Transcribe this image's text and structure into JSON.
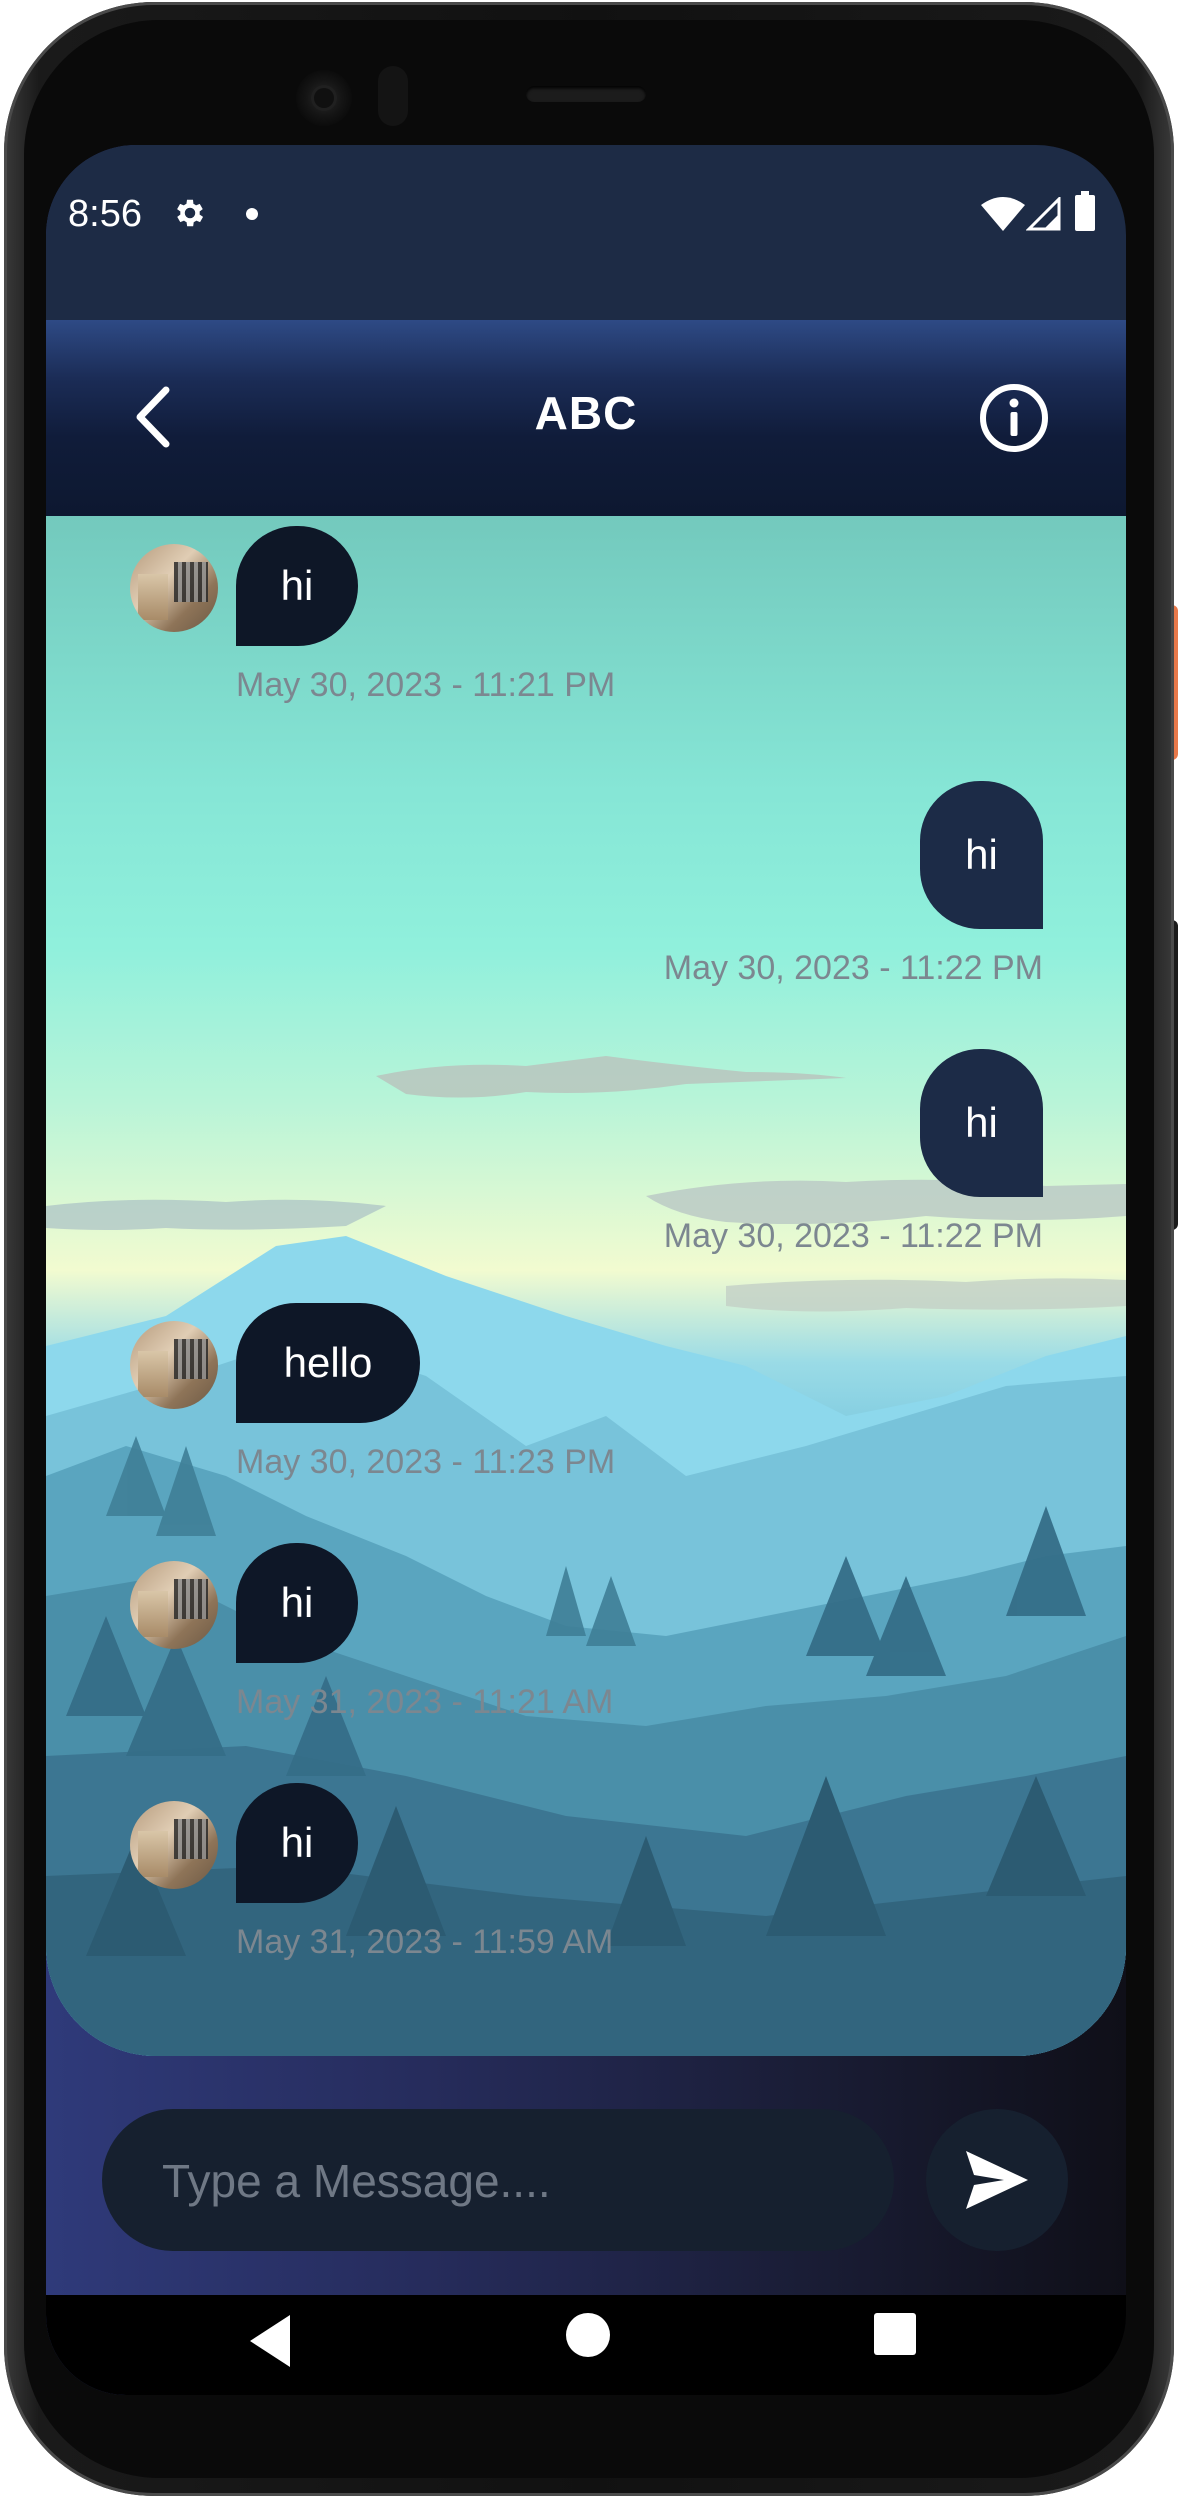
{
  "status_bar": {
    "time": "8:56",
    "icons": [
      "gear-icon",
      "notification-dot-icon",
      "wifi-icon",
      "signal-icon",
      "battery-icon"
    ]
  },
  "header": {
    "title": "ABC",
    "back_icon": "chevron-left-icon",
    "info_icon": "info-circle-icon"
  },
  "messages": [
    {
      "direction": "incoming",
      "text": "hi",
      "timestamp": "May 30, 2023 - 11:21 PM"
    },
    {
      "direction": "outgoing",
      "text": "hi",
      "timestamp": "May 30, 2023 - 11:22 PM"
    },
    {
      "direction": "outgoing",
      "text": "hi",
      "timestamp": "May 30, 2023 - 11:22 PM"
    },
    {
      "direction": "incoming",
      "text": "hello",
      "timestamp": "May 30, 2023 - 11:23 PM"
    },
    {
      "direction": "incoming",
      "text": "hi",
      "timestamp": "May 31, 2023 - 11:21 AM"
    },
    {
      "direction": "incoming",
      "text": "hi",
      "timestamp": "May 31, 2023 - 11:59 AM"
    }
  ],
  "composer": {
    "placeholder": "Type a Message....",
    "value": "",
    "send_icon": "send-icon"
  },
  "nav_bar": {
    "icons": [
      "nav-back-icon",
      "nav-home-icon",
      "nav-recents-icon"
    ]
  },
  "colors": {
    "status_bar_bg": "#1d2b45",
    "incoming_bubble": "#0e1727",
    "outgoing_bubble": "#1c2b47",
    "timestamp_text": "#7c8790",
    "composer_bg": "#16202f"
  }
}
